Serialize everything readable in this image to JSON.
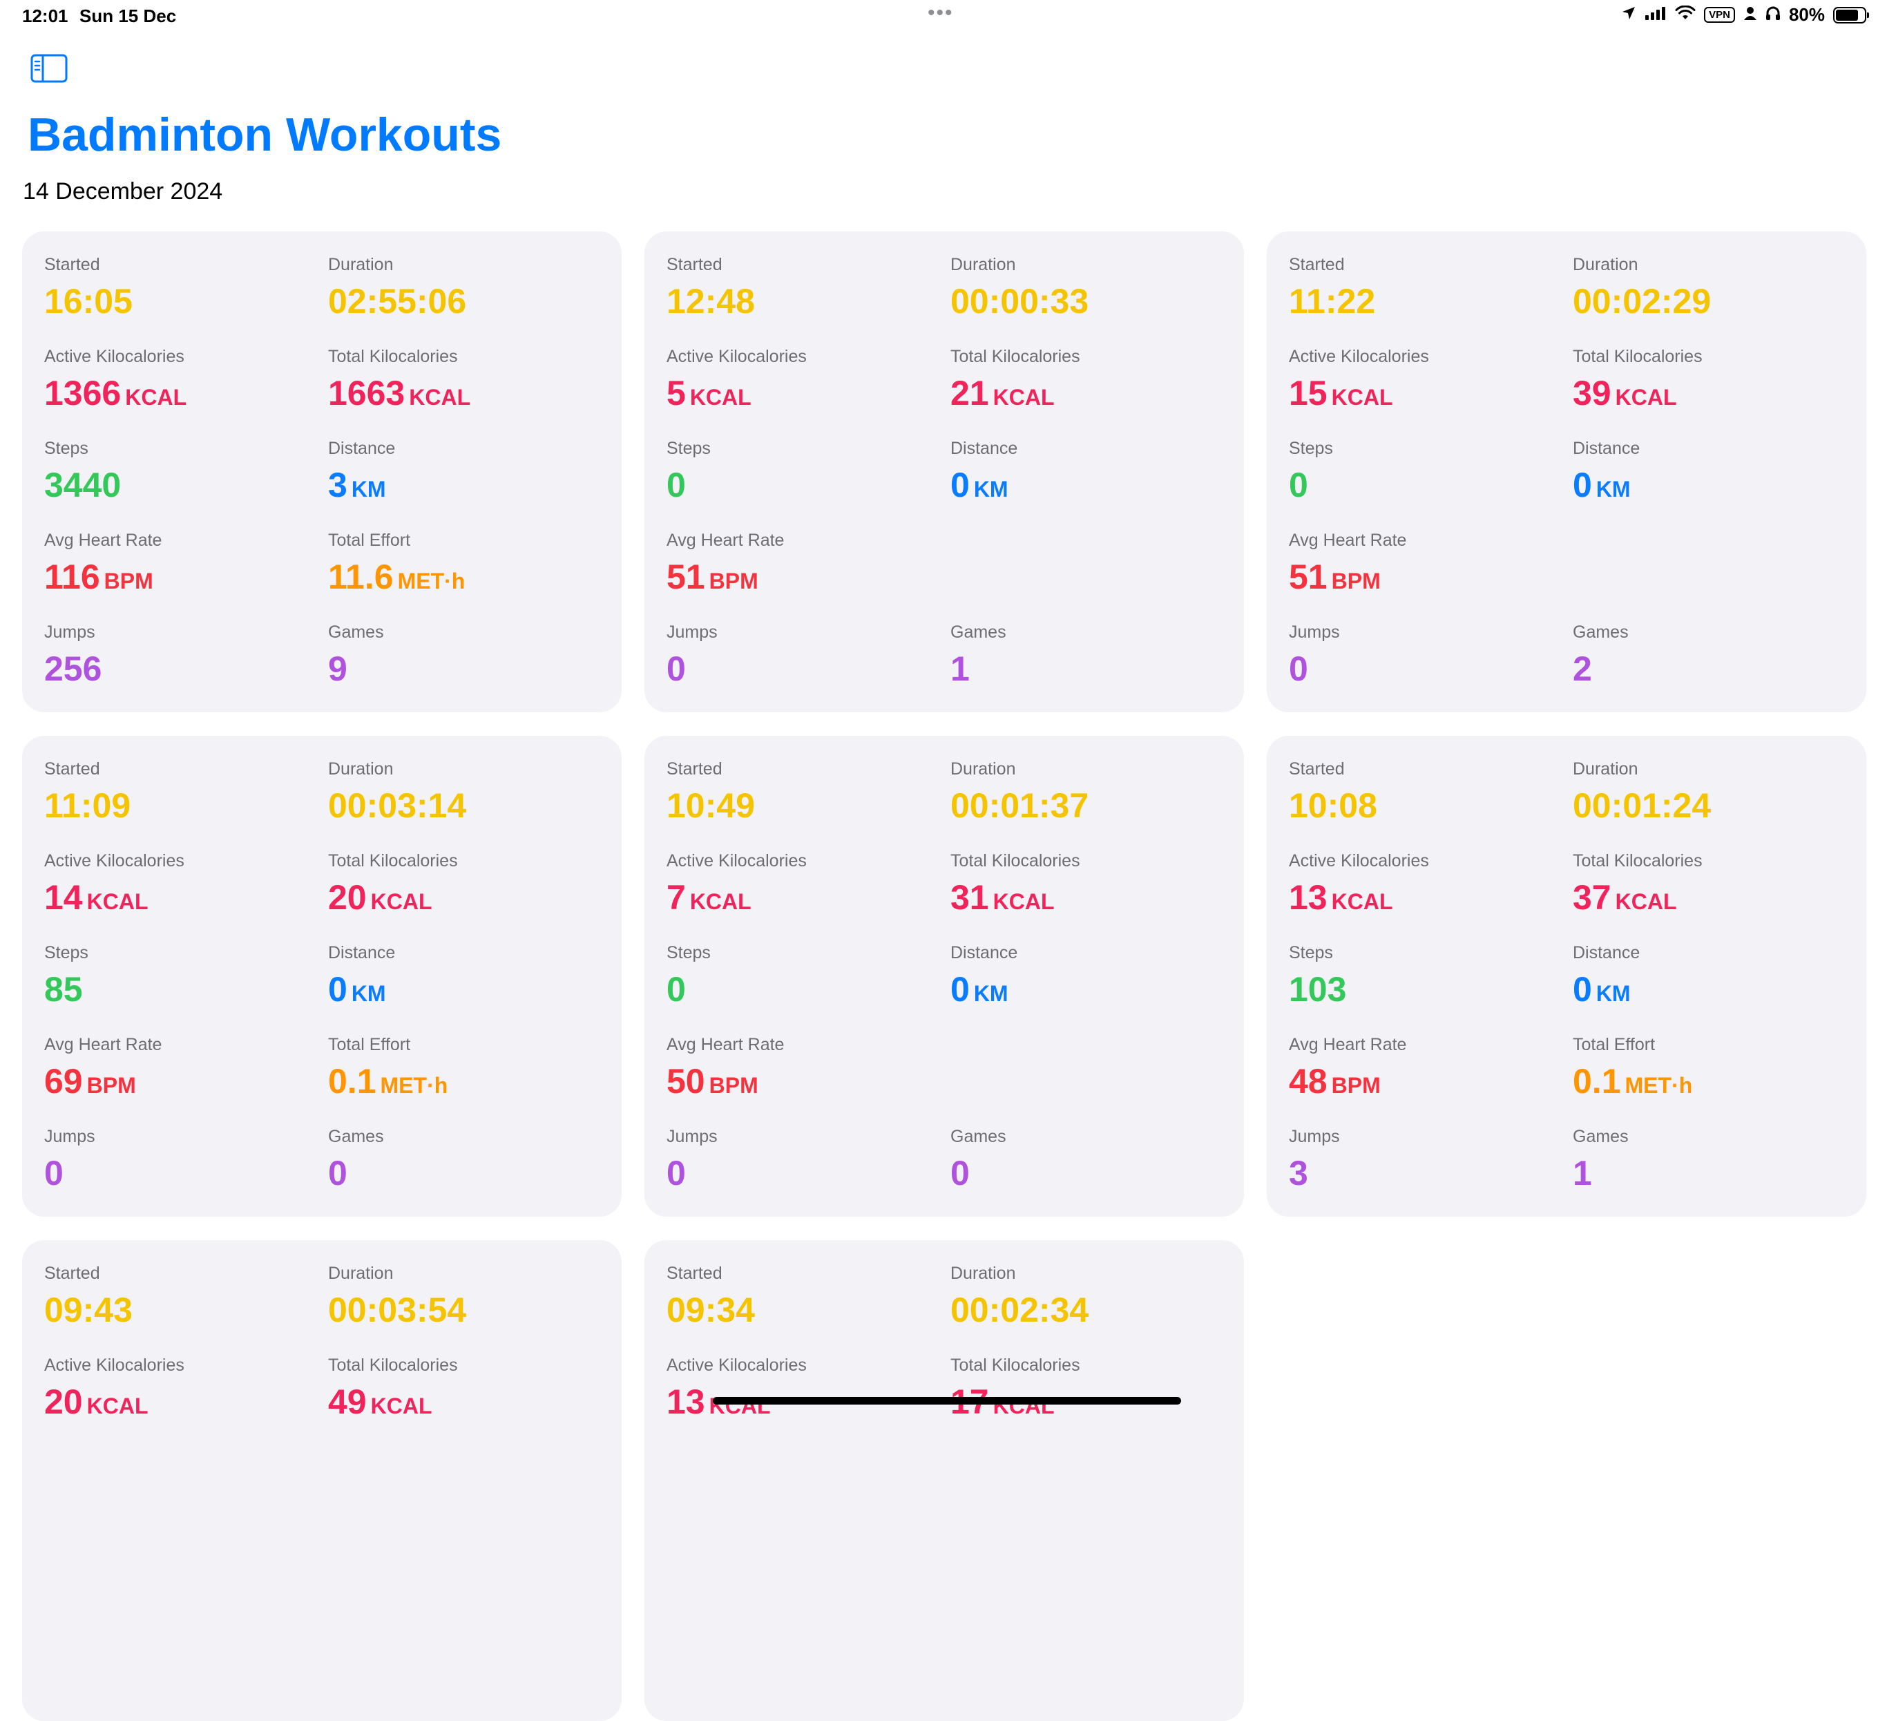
{
  "status_bar": {
    "time": "12:01",
    "date": "Sun 15 Dec",
    "vpn": "VPN",
    "battery": "80%",
    "battery_level": 0.8,
    "icons": [
      "location-arrow-icon",
      "cellular-signal-icon",
      "wifi-icon",
      "vpn-badge",
      "person-icon",
      "headphones-icon",
      "battery-icon"
    ]
  },
  "header": {
    "title": "Badminton Workouts",
    "date": "14 December 2024",
    "sidebar_icon": "sidebar-toggle-icon"
  },
  "colors": {
    "accent": "#007aff",
    "card_bg": "#f2f2f7",
    "started": "#f5c400",
    "kcal": "#f0245a",
    "steps": "#34c759",
    "distance": "#0a7cff",
    "heart": "#f5333f",
    "effort": "#ff9500",
    "count": "#af52de"
  },
  "workouts": [
    {
      "started": {
        "label": "Started",
        "value": "16:05"
      },
      "duration": {
        "label": "Duration",
        "value": "02:55:06"
      },
      "active_kcal": {
        "label": "Active Kilocalories",
        "value": "1366",
        "unit": "KCAL"
      },
      "total_kcal": {
        "label": "Total Kilocalories",
        "value": "1663",
        "unit": "KCAL"
      },
      "steps": {
        "label": "Steps",
        "value": "3440"
      },
      "distance": {
        "label": "Distance",
        "value": "3",
        "unit": "KM"
      },
      "heart": {
        "label": "Avg Heart Rate",
        "value": "116",
        "unit": "BPM"
      },
      "effort": {
        "label": "Total Effort",
        "value": "11.6",
        "unit": "MET·h"
      },
      "jumps": {
        "label": "Jumps",
        "value": "256"
      },
      "games": {
        "label": "Games",
        "value": "9"
      }
    },
    {
      "started": {
        "label": "Started",
        "value": "12:48"
      },
      "duration": {
        "label": "Duration",
        "value": "00:00:33"
      },
      "active_kcal": {
        "label": "Active Kilocalories",
        "value": "5",
        "unit": "KCAL"
      },
      "total_kcal": {
        "label": "Total Kilocalories",
        "value": "21",
        "unit": "KCAL"
      },
      "steps": {
        "label": "Steps",
        "value": "0"
      },
      "distance": {
        "label": "Distance",
        "value": "0",
        "unit": "KM"
      },
      "heart": {
        "label": "Avg Heart Rate",
        "value": "51",
        "unit": "BPM"
      },
      "jumps": {
        "label": "Jumps",
        "value": "0"
      },
      "games": {
        "label": "Games",
        "value": "1"
      }
    },
    {
      "started": {
        "label": "Started",
        "value": "11:22"
      },
      "duration": {
        "label": "Duration",
        "value": "00:02:29"
      },
      "active_kcal": {
        "label": "Active Kilocalories",
        "value": "15",
        "unit": "KCAL"
      },
      "total_kcal": {
        "label": "Total Kilocalories",
        "value": "39",
        "unit": "KCAL"
      },
      "steps": {
        "label": "Steps",
        "value": "0"
      },
      "distance": {
        "label": "Distance",
        "value": "0",
        "unit": "KM"
      },
      "heart": {
        "label": "Avg Heart Rate",
        "value": "51",
        "unit": "BPM"
      },
      "jumps": {
        "label": "Jumps",
        "value": "0"
      },
      "games": {
        "label": "Games",
        "value": "2"
      }
    },
    {
      "started": {
        "label": "Started",
        "value": "11:09"
      },
      "duration": {
        "label": "Duration",
        "value": "00:03:14"
      },
      "active_kcal": {
        "label": "Active Kilocalories",
        "value": "14",
        "unit": "KCAL"
      },
      "total_kcal": {
        "label": "Total Kilocalories",
        "value": "20",
        "unit": "KCAL"
      },
      "steps": {
        "label": "Steps",
        "value": "85"
      },
      "distance": {
        "label": "Distance",
        "value": "0",
        "unit": "KM"
      },
      "heart": {
        "label": "Avg Heart Rate",
        "value": "69",
        "unit": "BPM"
      },
      "effort": {
        "label": "Total Effort",
        "value": "0.1",
        "unit": "MET·h"
      },
      "jumps": {
        "label": "Jumps",
        "value": "0"
      },
      "games": {
        "label": "Games",
        "value": "0"
      }
    },
    {
      "started": {
        "label": "Started",
        "value": "10:49"
      },
      "duration": {
        "label": "Duration",
        "value": "00:01:37"
      },
      "active_kcal": {
        "label": "Active Kilocalories",
        "value": "7",
        "unit": "KCAL"
      },
      "total_kcal": {
        "label": "Total Kilocalories",
        "value": "31",
        "unit": "KCAL"
      },
      "steps": {
        "label": "Steps",
        "value": "0"
      },
      "distance": {
        "label": "Distance",
        "value": "0",
        "unit": "KM"
      },
      "heart": {
        "label": "Avg Heart Rate",
        "value": "50",
        "unit": "BPM"
      },
      "jumps": {
        "label": "Jumps",
        "value": "0"
      },
      "games": {
        "label": "Games",
        "value": "0"
      }
    },
    {
      "started": {
        "label": "Started",
        "value": "10:08"
      },
      "duration": {
        "label": "Duration",
        "value": "00:01:24"
      },
      "active_kcal": {
        "label": "Active Kilocalories",
        "value": "13",
        "unit": "KCAL"
      },
      "total_kcal": {
        "label": "Total Kilocalories",
        "value": "37",
        "unit": "KCAL"
      },
      "steps": {
        "label": "Steps",
        "value": "103"
      },
      "distance": {
        "label": "Distance",
        "value": "0",
        "unit": "KM"
      },
      "heart": {
        "label": "Avg Heart Rate",
        "value": "48",
        "unit": "BPM"
      },
      "effort": {
        "label": "Total Effort",
        "value": "0.1",
        "unit": "MET·h"
      },
      "jumps": {
        "label": "Jumps",
        "value": "3"
      },
      "games": {
        "label": "Games",
        "value": "1"
      }
    },
    {
      "started": {
        "label": "Started",
        "value": "09:43"
      },
      "duration": {
        "label": "Duration",
        "value": "00:03:54"
      },
      "active_kcal": {
        "label": "Active Kilocalories",
        "value": "20",
        "unit": "KCAL"
      },
      "total_kcal": {
        "label": "Total Kilocalories",
        "value": "49",
        "unit": "KCAL"
      }
    },
    {
      "started": {
        "label": "Started",
        "value": "09:34"
      },
      "duration": {
        "label": "Duration",
        "value": "00:02:34"
      },
      "active_kcal": {
        "label": "Active Kilocalories",
        "value": "13",
        "unit": "KCAL"
      },
      "total_kcal": {
        "label": "Total Kilocalories",
        "value": "17",
        "unit": "KCAL"
      }
    }
  ]
}
